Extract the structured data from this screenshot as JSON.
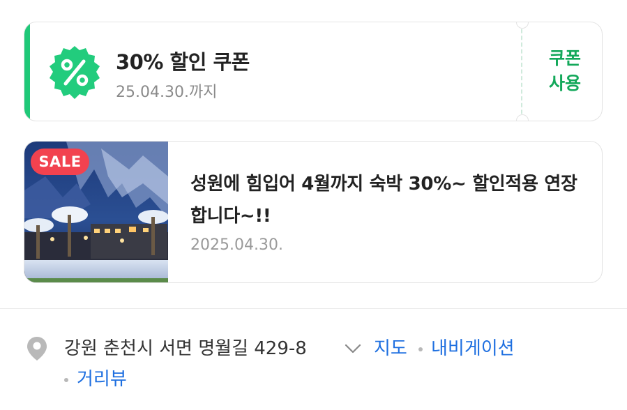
{
  "coupon": {
    "title": "30% 할인 쿠폰",
    "expiry": "25.04.30.까지",
    "use_line1": "쿠폰",
    "use_line2": "사용",
    "badge_icon": "percent-icon",
    "accent_color": "#1fc878",
    "badge_color": "#22cc7d",
    "use_color": "#13a85a"
  },
  "news": {
    "badge": "SALE",
    "badge_color": "#f2424f",
    "title": "성원에 힘입어 4월까지 숙박 30%~ 할인적용 연장합니다~!!",
    "date": "2025.04.30."
  },
  "location": {
    "address": "강원 춘천시 서면 명월길 429-8",
    "pin_icon": "map-pin-icon",
    "expand_icon": "chevron-down-icon",
    "links": [
      "지도",
      "내비게이션",
      "거리뷰"
    ],
    "link_color": "#1e6fe0"
  }
}
